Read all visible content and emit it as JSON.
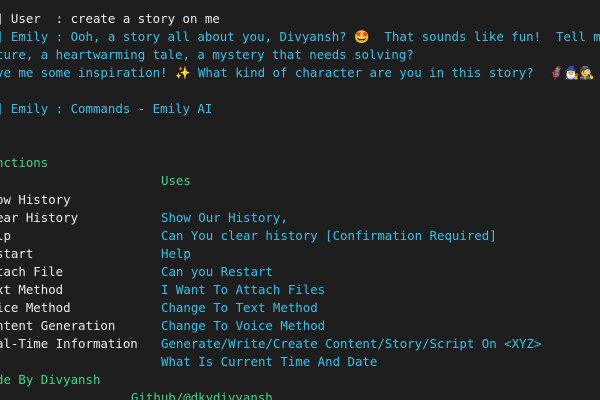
{
  "conversation": {
    "user_line": "] User  : create a story on me",
    "emily_line_1": "] Emily : Ooh, a story all about you, Divyansh? 🤩  That sounds like fun!  Tell me",
    "emily_line_2": "ture, a heartwarming tale, a mystery that needs solving?",
    "emily_line_3": "ve me some inspiration! ✨ What kind of character are you in this story?  🦸‍♂️🧙‍♂️🕵️",
    "commands_line": "] Emily : Commands - Emily AI"
  },
  "commands_table": {
    "header_functions": "nctions",
    "header_uses": "Uses",
    "rows": [
      {
        "function": "ow History",
        "use": "Show Our History,"
      },
      {
        "function": "ear History",
        "use": "Can You clear history [Confirmation Required]"
      },
      {
        "function": "lp",
        "use": "Help"
      },
      {
        "function": "start",
        "use": "Can you Restart"
      },
      {
        "function": "tach File",
        "use": "I Want To Attach Files"
      },
      {
        "function": "xt Method",
        "use": "Change To Text Method"
      },
      {
        "function": "ice Method",
        "use": "Change To Voice Method"
      },
      {
        "function": "ntent Generation",
        "use": "Generate/Write/Create Content/Story/Script On <XYZ>"
      },
      {
        "function": "al-Time Information",
        "use": "What Is Current Time And Date"
      }
    ]
  },
  "footer": {
    "made_by": "de By Divyansh",
    "github": "Github/@dkydivyansh"
  },
  "colors": {
    "background": "#1e1e1e",
    "user_text": "#ececec",
    "emily_text": "#33c3ea",
    "header_text": "#3dd68c"
  }
}
